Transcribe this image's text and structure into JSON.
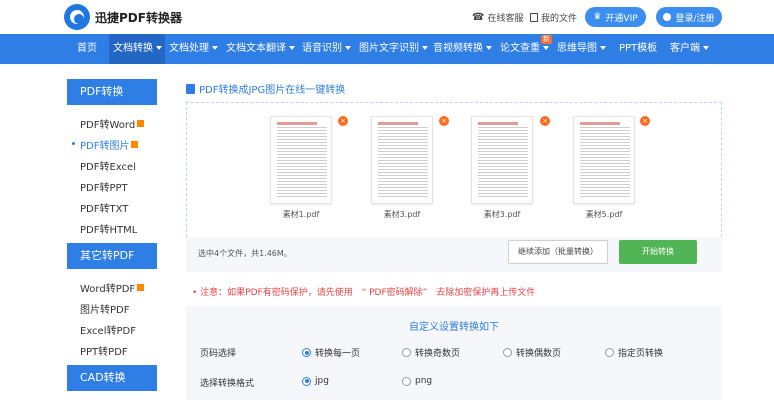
{
  "header": {
    "brand": "迅捷PDF转换器",
    "online_service": "在线客服",
    "my_files": "我的文件",
    "vip_button": "开通VIP",
    "login_button": "登录/注册"
  },
  "nav": {
    "items": [
      {
        "label": "首页",
        "caret": false
      },
      {
        "label": "文档转换",
        "caret": true
      },
      {
        "label": "文档处理",
        "caret": true
      },
      {
        "label": "文档文本翻译",
        "caret": true
      },
      {
        "label": "语音识别",
        "caret": true
      },
      {
        "label": "图片文字识别",
        "caret": true
      },
      {
        "label": "音视频转换",
        "caret": true
      },
      {
        "label": "论文查重",
        "caret": true
      },
      {
        "label": "思维导图",
        "caret": true
      },
      {
        "label": "PPT模板",
        "caret": false
      },
      {
        "label": "客户端",
        "caret": true
      }
    ],
    "new_badge": "新"
  },
  "sidebar": {
    "sections": [
      {
        "title": "PDF转换",
        "items": [
          "PDF转Word",
          "PDF转图片",
          "PDF转Excel",
          "PDF转PPT",
          "PDF转TXT",
          "PDF转HTML"
        ]
      },
      {
        "title": "其它转PDF",
        "items": [
          "Word转PDF",
          "图片转PDF",
          "Excel转PDF",
          "PPT转PDF"
        ]
      },
      {
        "title": "CAD转换",
        "items": []
      }
    ],
    "active_item": "PDF转图片"
  },
  "main": {
    "title": "PDF转换成JPG图片在线一键转换",
    "files": [
      "素材1.pdf",
      "素材3.pdf",
      "素材3.pdf",
      "素材5.pdf"
    ],
    "close_glyph": "×",
    "status": "选中4个文件，共1.46M。",
    "add_button": "继续添加（批量转换）",
    "start_button": "开始转换",
    "notice_prefix": "•  注意：如果PDF有密码保护，请先使用",
    "notice_link": "“ PDF密码解除”",
    "notice_suffix": "去除加密保护再上传文件"
  },
  "settings": {
    "title": "自定义设置转换如下",
    "page_label": "页码选择",
    "page_options": [
      {
        "label": "转换每一页",
        "selected": true
      },
      {
        "label": "转换奇数页",
        "selected": false
      },
      {
        "label": "转换偶数页",
        "selected": false
      },
      {
        "label": "指定页转换",
        "selected": false
      }
    ],
    "format_label": "选择转换格式",
    "format_options": [
      {
        "label": "jpg",
        "selected": true
      },
      {
        "label": "png",
        "selected": false
      }
    ]
  },
  "colors": {
    "primary": "#2f7ee5",
    "start_button": "#52b555",
    "close_badge": "#ff6a1f",
    "notice": "#ee4444"
  }
}
